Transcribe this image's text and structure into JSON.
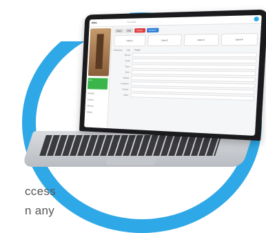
{
  "caption": {
    "line1": "ccess",
    "line2": "n any"
  },
  "app": {
    "logo": "Ditto",
    "breadcrumb": "Ab Detail",
    "sidebar": {
      "items": [
        {
          "label": "Info"
        },
        {
          "label": "Details"
        },
        {
          "label": "Listing"
        },
        {
          "label": "Photos"
        },
        {
          "label": "Share"
        }
      ]
    },
    "header_buttons": [
      {
        "label": "Save"
      },
      {
        "label": "Edit"
      },
      {
        "label": "Delete"
      },
      {
        "label": "Publish"
      }
    ],
    "cards": [
      {
        "label": "Card 1"
      },
      {
        "label": "Card 2"
      },
      {
        "label": "Card 3"
      },
      {
        "label": "Card 4"
      }
    ],
    "tabs": [
      {
        "label": "Overview"
      },
      {
        "label": "Info"
      },
      {
        "label": "Fields"
      }
    ],
    "fields": [
      {
        "label": "Name",
        "value": ""
      },
      {
        "label": "Code",
        "value": ""
      },
      {
        "label": "Type",
        "value": ""
      },
      {
        "label": "Size",
        "value": ""
      },
      {
        "label": "Status",
        "value": ""
      },
      {
        "label": "Location",
        "value": ""
      },
      {
        "label": "Owner",
        "value": ""
      },
      {
        "label": "Date",
        "value": ""
      }
    ]
  }
}
